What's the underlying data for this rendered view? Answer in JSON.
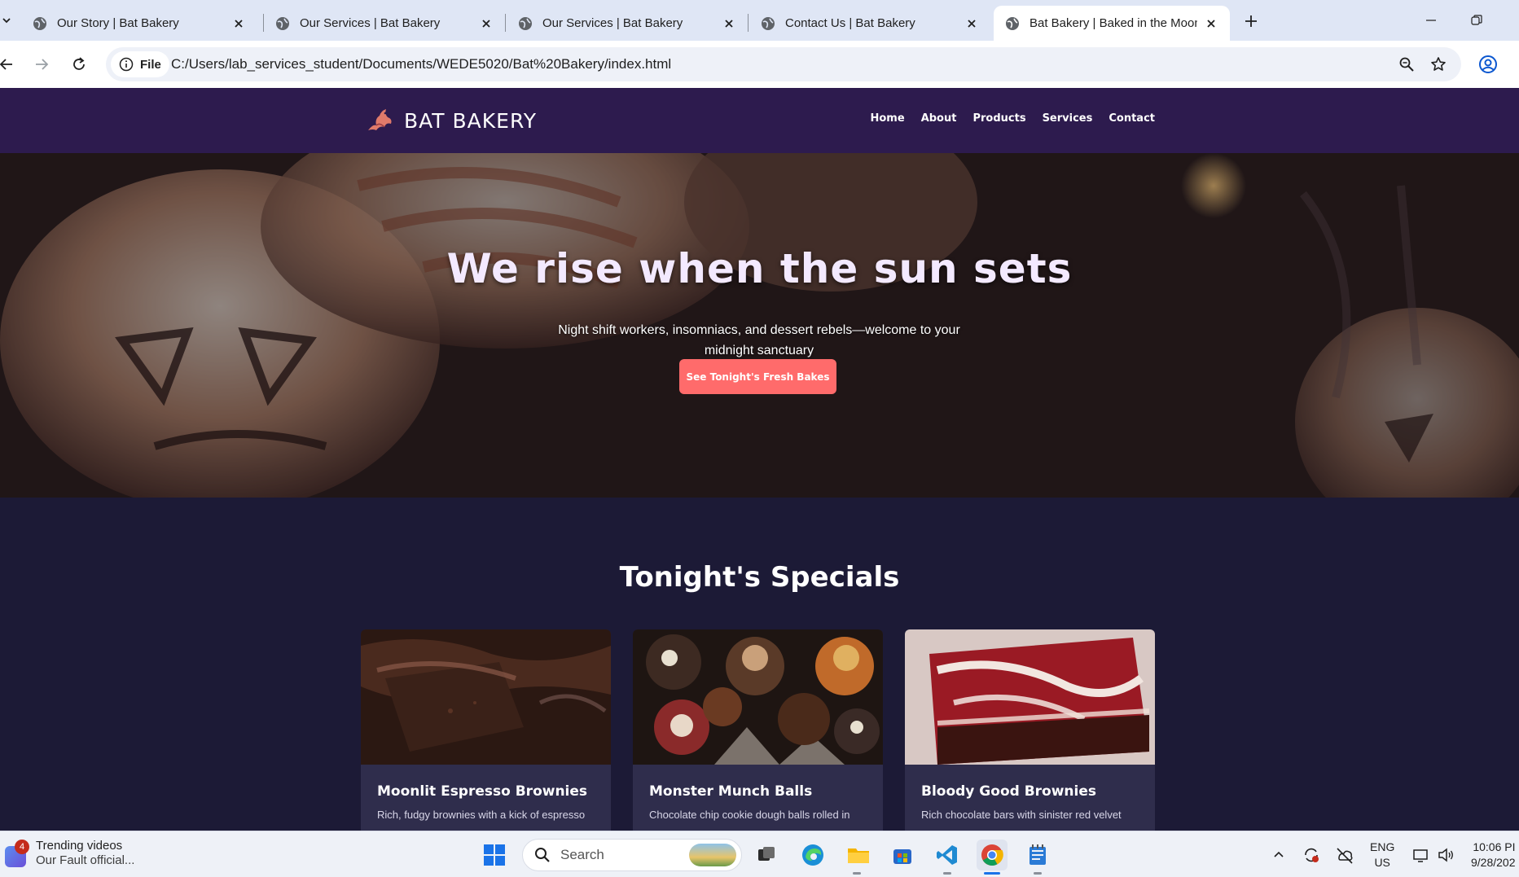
{
  "browser": {
    "tabs": [
      {
        "title": "Our Story | Bat Bakery",
        "active": false
      },
      {
        "title": "Our Services | Bat Bakery",
        "active": false
      },
      {
        "title": "Our Services | Bat Bakery",
        "active": false
      },
      {
        "title": "Contact Us | Bat Bakery",
        "active": false
      },
      {
        "title": "Bat Bakery | Baked in the Moonlight",
        "active": true
      }
    ],
    "site_chip": "File",
    "url": "C:/Users/lab_services_student/Documents/WEDE5020/Bat%20Bakery/index.html"
  },
  "site": {
    "brand": "BAT BAKERY",
    "nav": [
      "Home",
      "About",
      "Products",
      "Services",
      "Contact"
    ],
    "hero": {
      "title": "We rise when the sun sets",
      "subtitle": "Night shift workers, insomniacs, and dessert rebels—welcome to your midnight sanctuary",
      "cta": "See Tonight's Fresh Bakes"
    },
    "specials": {
      "title": "Tonight's Specials",
      "items": [
        {
          "name": "Moonlit Espresso Brownies",
          "desc": "Rich, fudgy brownies with a kick of espresso"
        },
        {
          "name": "Monster Munch Balls",
          "desc": "Chocolate chip cookie dough balls rolled in"
        },
        {
          "name": "Bloody Good Brownies",
          "desc": "Rich chocolate bars with sinister red velvet"
        }
      ]
    },
    "colors": {
      "header": "#2d1b4e",
      "cta": "#ff6b6b",
      "section": "#1c1a36",
      "card": "#2f2d4c"
    }
  },
  "taskbar": {
    "widget": {
      "badge": "4",
      "title": "Trending videos",
      "subtitle": "Our Fault official..."
    },
    "search_placeholder": "Search",
    "lang": {
      "line1": "ENG",
      "line2": "US"
    },
    "clock": {
      "time": "10:06 PI",
      "date": "9/28/202"
    }
  }
}
